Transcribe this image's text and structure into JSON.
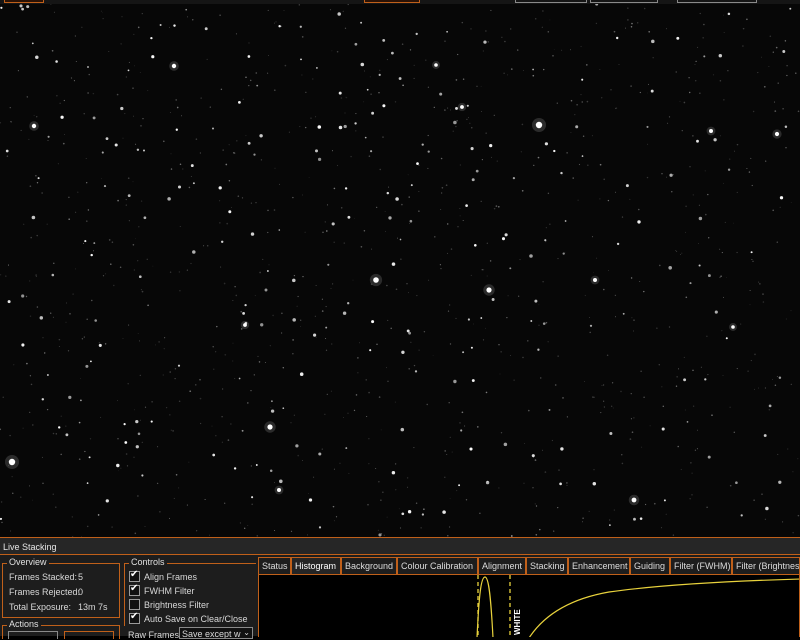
{
  "panel": {
    "title": "Live Stacking"
  },
  "overview": {
    "label": "Overview",
    "rows": [
      {
        "name": "Frames Stacked:",
        "value": "5"
      },
      {
        "name": "Frames Rejected:",
        "value": "0"
      },
      {
        "name": "Total Exposure:",
        "value": "13m 7s"
      }
    ]
  },
  "actions": {
    "label": "Actions"
  },
  "controls": {
    "label": "Controls",
    "checkboxes": [
      {
        "label": "Align Frames",
        "checked": true
      },
      {
        "label": "FWHM Filter",
        "checked": true
      },
      {
        "label": "Brightness Filter",
        "checked": false
      },
      {
        "label": "Auto Save on Clear/Close",
        "checked": true
      }
    ],
    "raw_frames_label": "Raw Frames",
    "raw_frames_value": "Save except w"
  },
  "tabs": [
    "Status",
    "Histogram",
    "Background",
    "Colour Calibration",
    "Alignment",
    "Stacking",
    "Enhancement",
    "Guiding",
    "Filter (FWHM)",
    "Filter (Brightness)"
  ],
  "active_tab": "Histogram",
  "histogram": {
    "marker_text": "WHITE",
    "curve_color": "#e8d23c",
    "marker_color": "#e8d23c"
  },
  "colors": {
    "accent": "#c0601a"
  }
}
